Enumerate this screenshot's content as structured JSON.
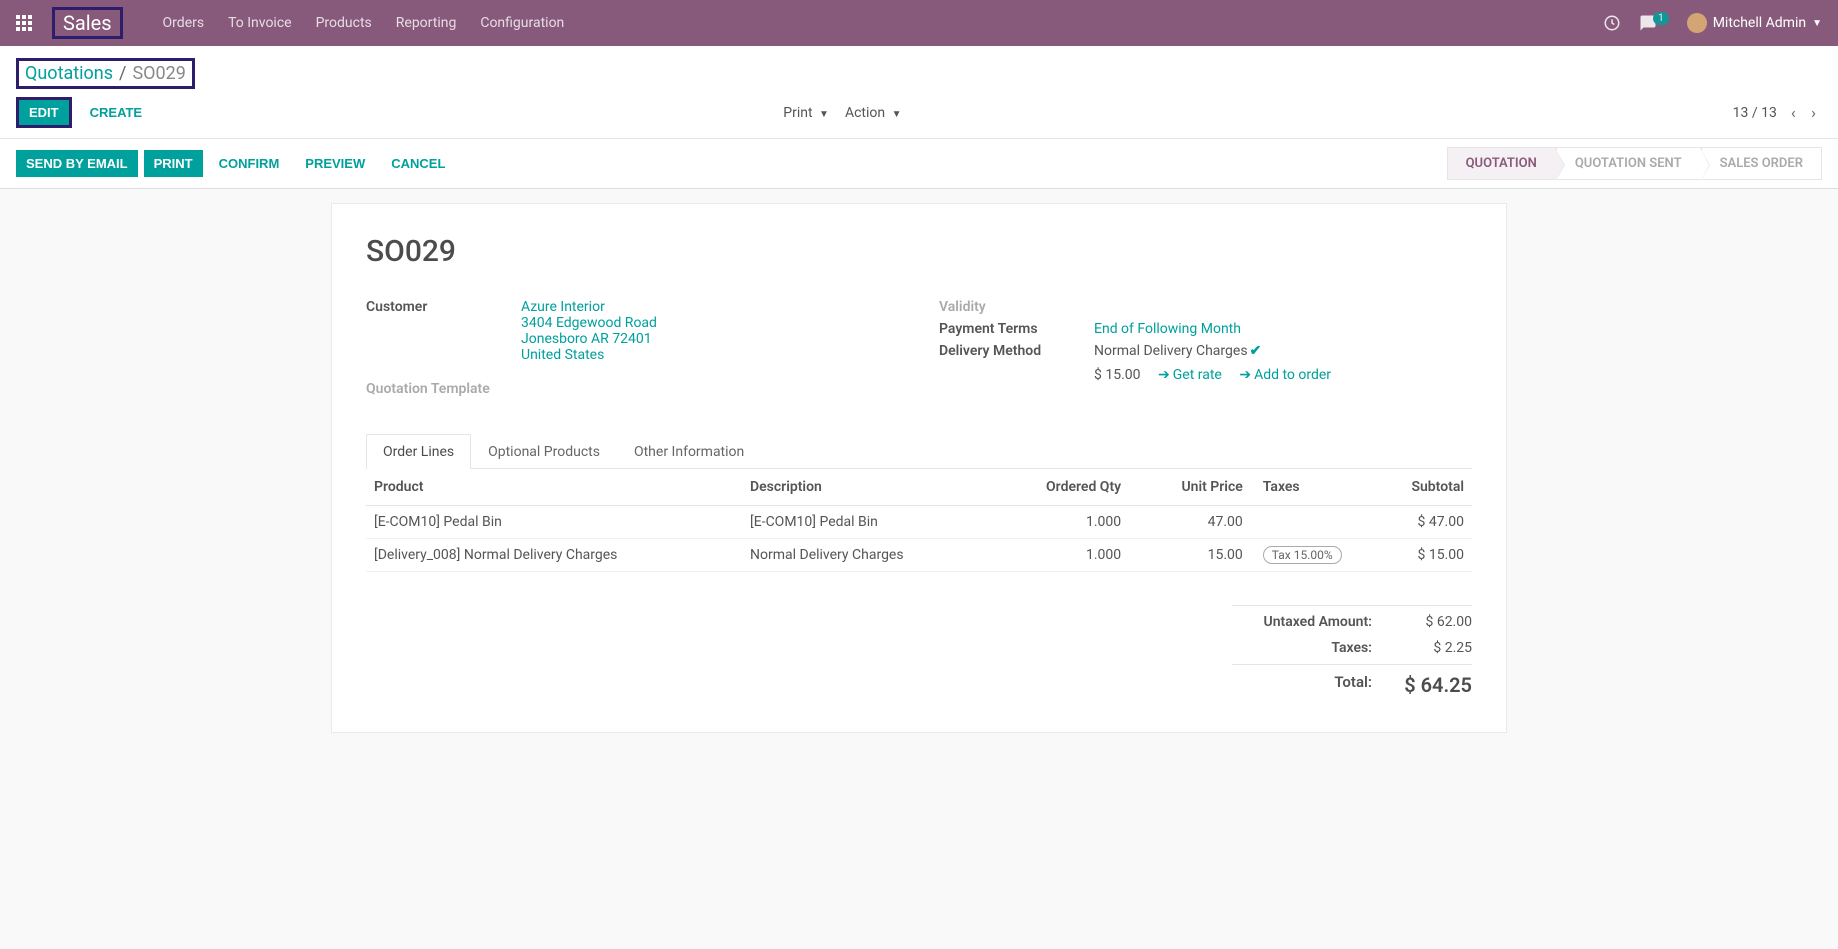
{
  "navbar": {
    "brand": "Sales",
    "menu": [
      "Orders",
      "To Invoice",
      "Products",
      "Reporting",
      "Configuration"
    ],
    "chat_count": "1",
    "user_name": "Mitchell Admin"
  },
  "breadcrumb": {
    "root": "Quotations",
    "current": "SO029"
  },
  "buttons": {
    "edit": "EDIT",
    "create": "CREATE",
    "print": "Print",
    "action": "Action",
    "send_email": "SEND BY EMAIL",
    "print2": "PRINT",
    "confirm": "CONFIRM",
    "preview": "PREVIEW",
    "cancel": "CANCEL"
  },
  "pager": {
    "text": "13 / 13"
  },
  "stages": {
    "quotation": "QUOTATION",
    "sent": "QUOTATION SENT",
    "sales_order": "SALES ORDER"
  },
  "record": {
    "name": "SO029",
    "labels": {
      "customer": "Customer",
      "quotation_template": "Quotation Template",
      "validity": "Validity",
      "payment_terms": "Payment Terms",
      "delivery_method": "Delivery Method"
    },
    "customer": {
      "name": "Azure Interior",
      "street": "3404 Edgewood Road",
      "city": "Jonesboro AR 72401",
      "country": "United States"
    },
    "payment_terms": "End of Following Month",
    "delivery_method": "Normal Delivery Charges",
    "delivery_cost": "$ 15.00",
    "get_rate": "Get rate",
    "add_to_order": "Add to order"
  },
  "tabs": {
    "order_lines": "Order Lines",
    "optional_products": "Optional Products",
    "other_info": "Other Information"
  },
  "table": {
    "headers": {
      "product": "Product",
      "description": "Description",
      "ordered_qty": "Ordered Qty",
      "unit_price": "Unit Price",
      "taxes": "Taxes",
      "subtotal": "Subtotal"
    },
    "rows": [
      {
        "product": "[E-COM10] Pedal Bin",
        "description": "[E-COM10] Pedal Bin",
        "qty": "1.000",
        "price": "47.00",
        "taxes": "",
        "subtotal": "$ 47.00"
      },
      {
        "product": "[Delivery_008] Normal Delivery Charges",
        "description": "Normal Delivery Charges",
        "qty": "1.000",
        "price": "15.00",
        "taxes": "Tax 15.00%",
        "subtotal": "$ 15.00"
      }
    ]
  },
  "totals": {
    "untaxed_label": "Untaxed Amount:",
    "untaxed_value": "$ 62.00",
    "taxes_label": "Taxes:",
    "taxes_value": "$ 2.25",
    "total_label": "Total:",
    "total_value": "$ 64.25"
  }
}
